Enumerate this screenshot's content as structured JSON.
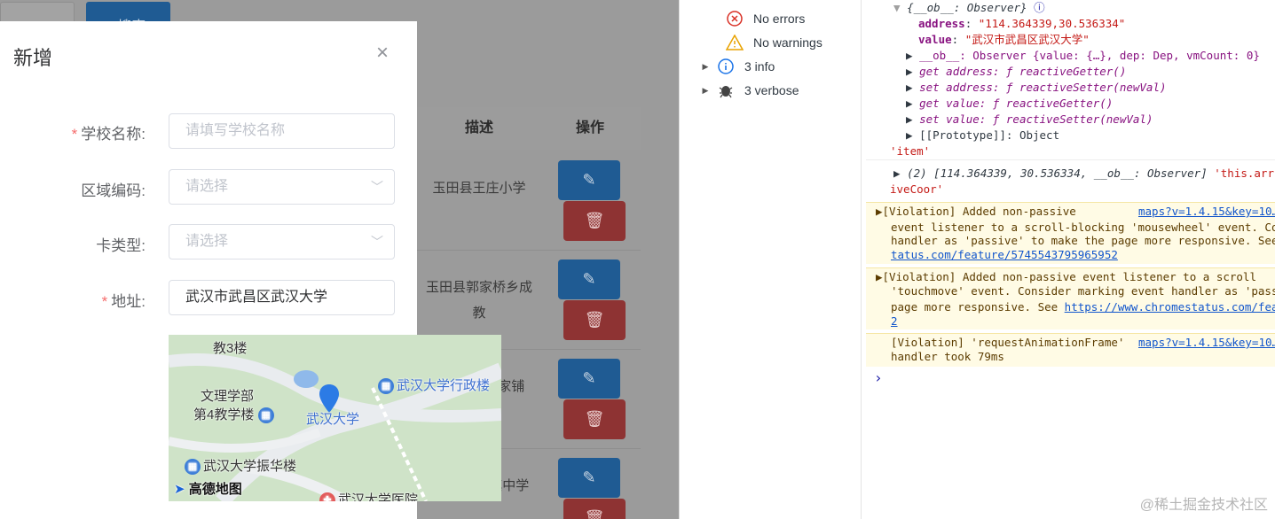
{
  "app": {
    "search_button": "搜索",
    "table_headers": {
      "desc": "描述",
      "action": "操作"
    },
    "rows": [
      {
        "desc": "玉田县王庄小学"
      },
      {
        "desc": "玉田县郭家桥乡成教"
      },
      {
        "desc": "...家铺"
      },
      {
        "desc": "...田镇中学"
      }
    ],
    "edit_icon": "edit-icon",
    "delete_icon": "trash-icon"
  },
  "dialog": {
    "title": "新增",
    "close": "×",
    "fields": {
      "school": {
        "label": "学校名称:",
        "required": true,
        "placeholder": "请填写学校名称"
      },
      "area": {
        "label": "区域编码:",
        "required": false,
        "placeholder": "请选择"
      },
      "card": {
        "label": "卡类型:",
        "required": false,
        "placeholder": "请选择"
      },
      "address": {
        "label": "地址:",
        "required": true,
        "value": "武汉市武昌区武汉大学"
      }
    },
    "map": {
      "labels": [
        "教3楼",
        "文理学部",
        "第4教学楼",
        "武汉大学",
        "武汉大学行政楼",
        "武汉大学振华楼",
        "武汉大学医院"
      ],
      "brand": "高德地图"
    }
  },
  "devtools": {
    "sidebar": [
      {
        "icon": "error-icon",
        "label": "No errors",
        "expandable": false
      },
      {
        "icon": "warning-icon",
        "label": "No warnings",
        "expandable": false
      },
      {
        "icon": "info-icon",
        "label": "3 info",
        "expandable": true
      },
      {
        "icon": "bug-icon",
        "label": "3 verbose",
        "expandable": true
      }
    ],
    "console": {
      "obj_header": "{__ob__: Observer}",
      "address_key": "address",
      "address_val": "\"114.364339,30.536334\"",
      "value_key": "value",
      "value_val": "\"武汉市武昌区武汉大学\"",
      "ob_line": "__ob__: Observer {value: {…}, dep: Dep, vmCount: 0}",
      "get_address": "get address: ƒ reactiveGetter()",
      "set_address": "set address: ƒ reactiveSetter(newVal)",
      "get_value": "get value: ƒ reactiveGetter()",
      "set_value": "set value: ƒ reactiveSetter(newVal)",
      "prototype": "[[Prototype]]: Object",
      "item_str": "'item'",
      "array_line": "(2) [114.364339, 30.536334, __ob__: Observer]",
      "array_str": "'this.arr",
      "array_str2": "iveCoor'",
      "warn1_a": "[Violation] Added non-passive",
      "warn1_link": "maps?v=1.4.15&key=10…",
      "warn1_b": "event listener to a scroll-blocking 'mousewheel' event. Cor",
      "warn1_c": "handler as 'passive' to make the page more responsive. See",
      "warn1_d": "tatus.com/feature/5745543795965952",
      "warn2_a": "[Violation] Added non-passive event listener to a scroll",
      "warn2_b": "'touchmove' event. Consider marking event handler as 'passi",
      "warn2_c": "page more responsive. See ",
      "warn2_link": "https://www.chromestatus.com/feat",
      "warn2_d": "2",
      "warn3_a": "[Violation] 'requestAnimationFrame'",
      "warn3_link": "maps?v=1.4.15&key=10…",
      "warn3_b": "handler took 79ms",
      "prompt": "›"
    },
    "watermark": "@稀土掘金技术社区"
  }
}
